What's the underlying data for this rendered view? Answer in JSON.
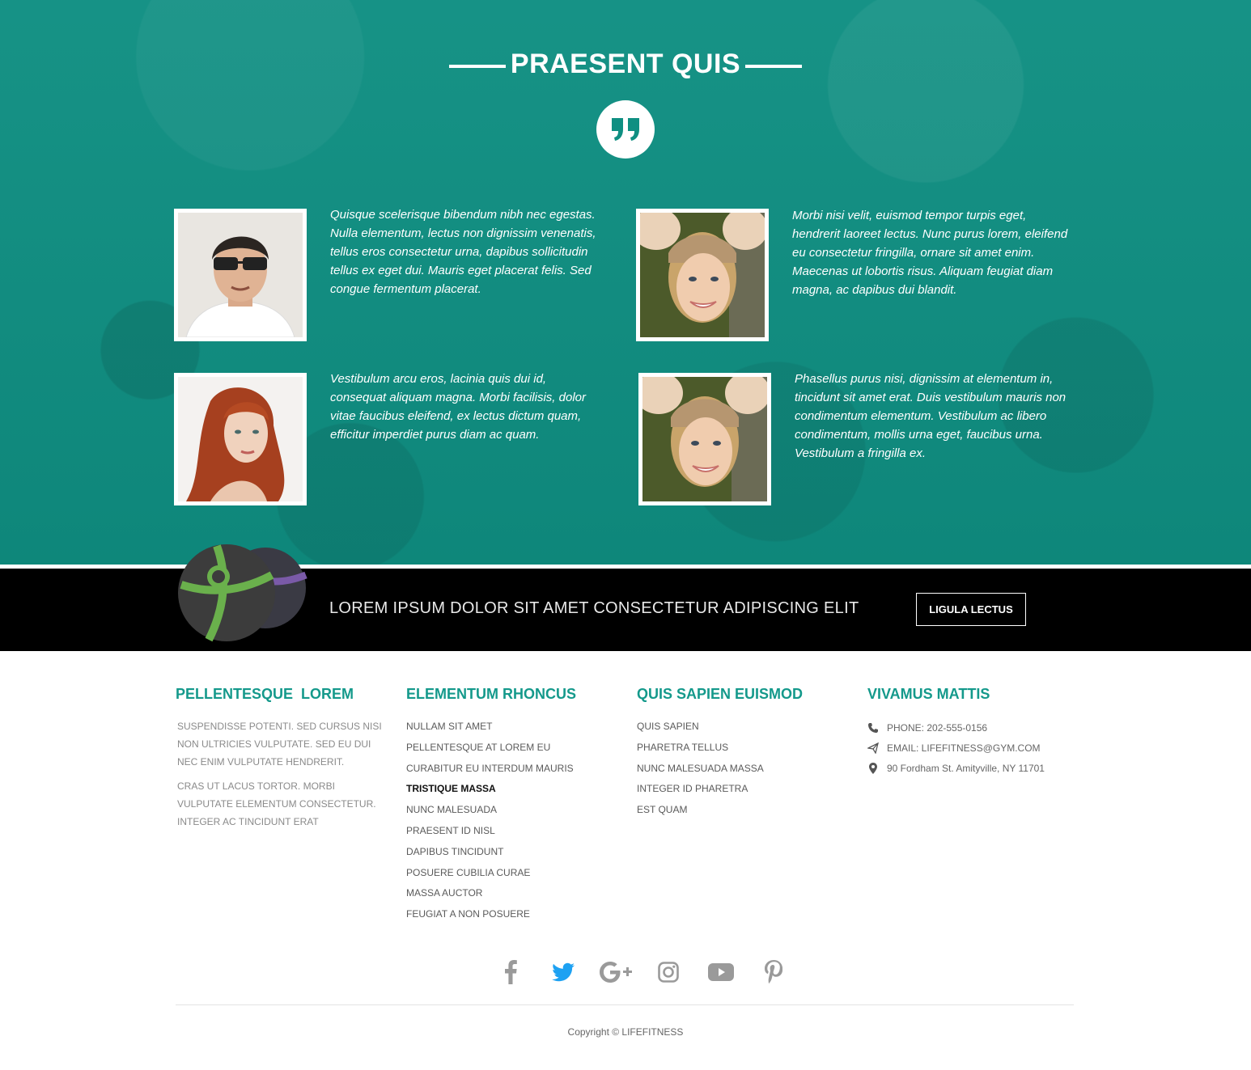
{
  "testimonials": {
    "title": "PRAESENT QUIS",
    "items": [
      {
        "text": "Quisque scelerisque bibendum nibh nec egestas. Nulla elementum, lectus non dignissim venenatis, tellus eros consectetur urna, dapibus sollicitudin tellus ex eget dui. Mauris eget placerat felis. Sed congue fermentum placerat."
      },
      {
        "text": "Morbi nisi velit, euismod tempor turpis eget, hendrerit laoreet lectus. Nunc purus lorem, eleifend eu consectetur fringilla, ornare sit amet enim. Maecenas ut lobortis risus. Aliquam feugiat diam magna, ac dapibus dui blandit."
      },
      {
        "text": "Vestibulum arcu eros, lacinia quis dui id, consequat aliquam magna. Morbi facilisis, dolor vitae faucibus eleifend, ex lectus dictum quam, efficitur imperdiet purus diam ac quam."
      },
      {
        "text": "Phasellus purus nisi, dignissim at elementum in, tincidunt sit amet erat. Duis vestibulum mauris non condimentum elementum. Vestibulum ac libero condimentum, mollis urna eget, faucibus urna. Vestibulum a fringilla ex."
      }
    ]
  },
  "promo": {
    "text": "LOREM IPSUM DOLOR SIT AMET CONSECTETUR ADIPISCING ELIT",
    "button": "LIGULA LECTUS"
  },
  "footer": {
    "col1": {
      "title": "PELLENTESQUE  LOREM",
      "paragraphs": [
        "SUSPENDISSE POTENTI. SED CURSUS NISI NON ULTRICIES VULPUTATE. SED EU DUI NEC ENIM VULPUTATE HENDRERIT.",
        "CRAS UT LACUS TORTOR. MORBI VULPUTATE ELEMENTUM CONSECTETUR. INTEGER AC TINCIDUNT ERAT"
      ]
    },
    "col2": {
      "title": "ELEMENTUM RHONCUS",
      "links": [
        "NULLAM SIT AMET",
        "PELLENTESQUE AT LOREM EU",
        "CURABITUR EU INTERDUM MAURIS",
        "TRISTIQUE MASSA",
        "NUNC MALESUADA",
        "PRAESENT ID NISL",
        "DAPIBUS TINCIDUNT",
        "POSUERE CUBILIA CURAE",
        "MASSA AUCTOR",
        "FEUGIAT A NON POSUERE"
      ]
    },
    "col3": {
      "title": "QUIS SAPIEN EUISMOD",
      "links": [
        "QUIS SAPIEN",
        "PHARETRA TELLUS",
        "NUNC MALESUADA MASSA",
        "INTEGER ID PHARETRA",
        "EST QUAM"
      ]
    },
    "col4": {
      "title": "VIVAMUS MATTIS",
      "phone": "PHONE: 202-555-0156",
      "email": "EMAIL: LIFEFITNESS@GYM.COM",
      "address": "90 Fordham St. Amityville, NY 11701"
    },
    "social": [
      "facebook-icon",
      "twitter-icon",
      "google-plus-icon",
      "instagram-icon",
      "youtube-icon",
      "pinterest-icon"
    ],
    "copyright": "Copyright © LIFEFITNESS"
  },
  "colors": {
    "teal": "#0f8f82",
    "heading_teal": "#14998b",
    "twitter_blue": "#1da1f2",
    "social_gray": "#9a9a9a"
  }
}
